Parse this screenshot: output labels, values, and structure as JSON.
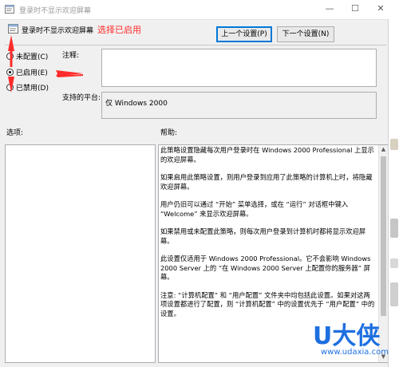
{
  "window": {
    "title": "登录时不显示欢迎屏幕",
    "buttons": {
      "minimize": "—",
      "maximize": "☐",
      "close": "✕"
    }
  },
  "header": {
    "policy_name": "登录时不显示欢迎屏幕"
  },
  "annotation": {
    "text": "选择已启用",
    "color": "#ff2b2b"
  },
  "nav": {
    "prev_label": "上一个设置(P)",
    "next_label": "下一个设置(N)"
  },
  "options": [
    {
      "label": "未配置(C)",
      "selected": false
    },
    {
      "label": "已启用(E)",
      "selected": true
    },
    {
      "label": "已禁用(D)",
      "selected": false
    }
  ],
  "comment": {
    "label": "注释:",
    "value": ""
  },
  "platform": {
    "label": "支持的平台:",
    "value": "仅 Windows 2000"
  },
  "sections": {
    "options_label": "选项:",
    "help_label": "帮助:"
  },
  "help": {
    "paragraphs": [
      "此策略设置隐藏每次用户登录时在 Windows 2000 Professional 上显示的欢迎屏幕。",
      "如果启用此策略设置，则用户登录到应用了此策略的计算机上时，将隐藏欢迎屏幕。",
      "用户仍旧可以通过 “开始” 菜单选择，或在 “运行” 对话框中键入 “Welcome” 来显示欢迎屏幕。",
      "如果禁用或未配置此策略，则每次用户登录到计算机时都将显示欢迎屏幕。",
      "此设置仅适用于 Windows 2000 Professional。它不会影响 Windows 2000 Server 上的 “在 Windows 2000 Server 上配置你的服务器” 屏幕。",
      "注意: “计算机配置” 和 “用户配置” 文件夹中均包括此设置。如果对这两项设置都进行了配置，则 “计算机配置” 中的设置优先于 “用户配置” 中的设置。"
    ]
  },
  "watermark": {
    "brand": "U大侠",
    "url": "www.udaxia.com",
    "color": "#1e6fe0"
  }
}
